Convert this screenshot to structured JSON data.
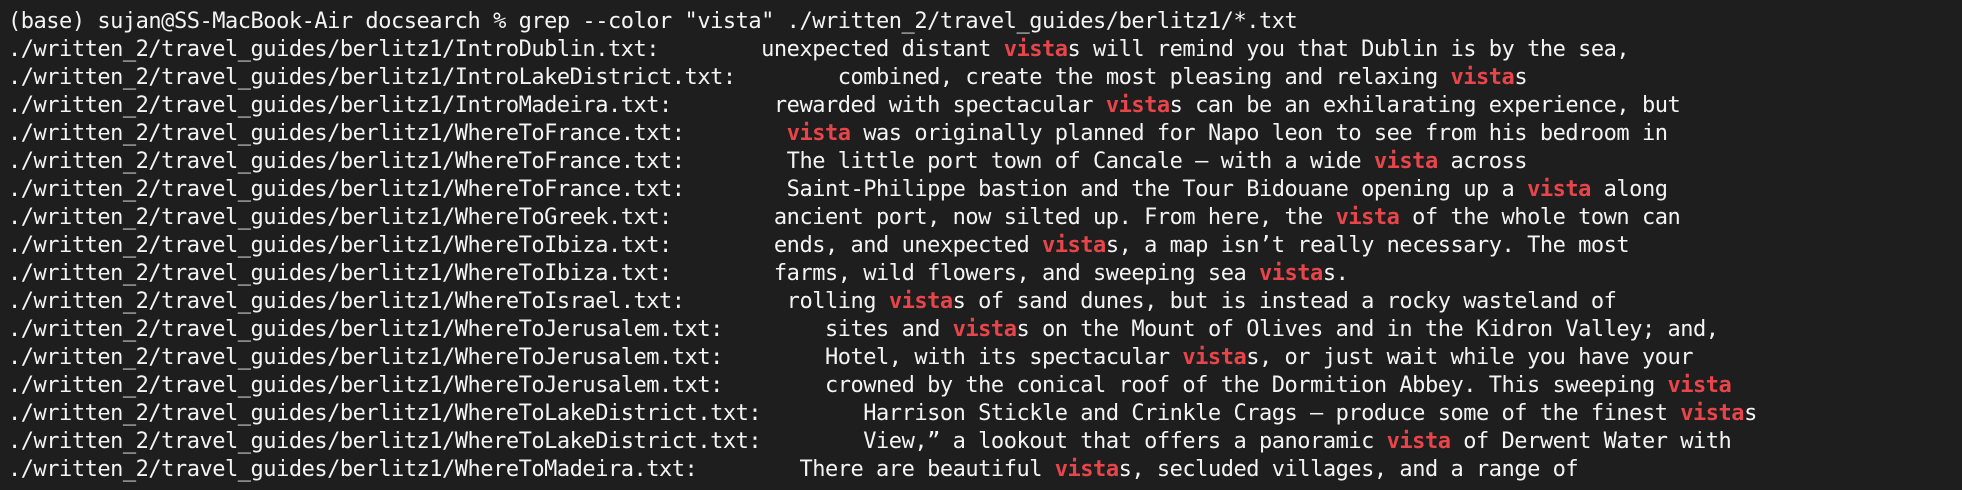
{
  "terminal": {
    "prompt": "(base) sujan@SS-MacBook-Air docsearch % grep --color \"vista\" ./written_2/travel_guides/berlitz1/*.txt",
    "match_color": "#e8454a",
    "lines": [
      {
        "file": "./written_2/travel_guides/berlitz1/IntroDublin.txt:",
        "text": "        unexpected distant ",
        "match": "vista",
        "after": "s will remind you that Dublin is by the sea,"
      },
      {
        "file": "./written_2/travel_guides/berlitz1/IntroLakeDistrict.txt:",
        "text": "        combined, create the most pleasing and relaxing ",
        "match": "vista",
        "after": "s"
      },
      {
        "file": "./written_2/travel_guides/berlitz1/IntroMadeira.txt:",
        "text": "        rewarded with spectacular ",
        "match": "vista",
        "after": "s can be an exhilarating experience, but"
      },
      {
        "file": "./written_2/travel_guides/berlitz1/WhereToFrance.txt:",
        "text": "        ",
        "match": "vista",
        "after": " was originally planned for Napo leon to see from his bedroom in"
      },
      {
        "file": "./written_2/travel_guides/berlitz1/WhereToFrance.txt:",
        "text": "        The little port town of Cancale — with a wide ",
        "match": "vista",
        "after": " across"
      },
      {
        "file": "./written_2/travel_guides/berlitz1/WhereToFrance.txt:",
        "text": "        Saint-Philippe bastion and the Tour Bidouane opening up a ",
        "match": "vista",
        "after": " along"
      },
      {
        "file": "./written_2/travel_guides/berlitz1/WhereToGreek.txt:",
        "text": "        ancient port, now silted up. From here, the ",
        "match": "vista",
        "after": " of the whole town can"
      },
      {
        "file": "./written_2/travel_guides/berlitz1/WhereToIbiza.txt:",
        "text": "        ends, and unexpected ",
        "match": "vista",
        "after": "s, a map isn’t really necessary. The most"
      },
      {
        "file": "./written_2/travel_guides/berlitz1/WhereToIbiza.txt:",
        "text": "        farms, wild flowers, and sweeping sea ",
        "match": "vista",
        "after": "s."
      },
      {
        "file": "./written_2/travel_guides/berlitz1/WhereToIsrael.txt:",
        "text": "        rolling ",
        "match": "vista",
        "after": "s of sand dunes, but is instead a rocky wasteland of"
      },
      {
        "file": "./written_2/travel_guides/berlitz1/WhereToJerusalem.txt:",
        "text": "        sites and ",
        "match": "vista",
        "after": "s on the Mount of Olives and in the Kidron Valley; and,"
      },
      {
        "file": "./written_2/travel_guides/berlitz1/WhereToJerusalem.txt:",
        "text": "        Hotel, with its spectacular ",
        "match": "vista",
        "after": "s, or just wait while you have your"
      },
      {
        "file": "./written_2/travel_guides/berlitz1/WhereToJerusalem.txt:",
        "text": "        crowned by the conical roof of the Dormition Abbey. This sweeping ",
        "match": "vista",
        "after": ""
      },
      {
        "file": "./written_2/travel_guides/berlitz1/WhereToLakeDistrict.txt:",
        "text": "        Harrison Stickle and Crinkle Crags — produce some of the finest ",
        "match": "vista",
        "after": "s"
      },
      {
        "file": "./written_2/travel_guides/berlitz1/WhereToLakeDistrict.txt:",
        "text": "        View,” a lookout that offers a panoramic ",
        "match": "vista",
        "after": " of Derwent Water with"
      },
      {
        "file": "./written_2/travel_guides/berlitz1/WhereToMadeira.txt:",
        "text": "        There are beautiful ",
        "match": "vista",
        "after": "s, secluded villages, and a range of"
      }
    ]
  }
}
